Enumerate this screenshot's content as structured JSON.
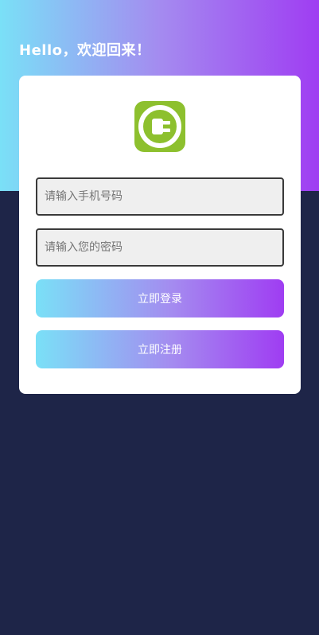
{
  "header": {
    "greeting": "Hello，欢迎回来！"
  },
  "logo": {
    "icon": "plug-icon",
    "bg_color": "#8dc02e"
  },
  "form": {
    "phone_placeholder": "请输入手机号码",
    "phone_value": "",
    "password_placeholder": "请输入您的密码",
    "password_value": ""
  },
  "actions": {
    "login_label": "立即登录",
    "register_label": "立即注册"
  },
  "colors": {
    "page_bg": "#1e2548",
    "gradient_start": "#7ae0f7",
    "gradient_end": "#9f3df2",
    "card_bg": "#ffffff"
  }
}
